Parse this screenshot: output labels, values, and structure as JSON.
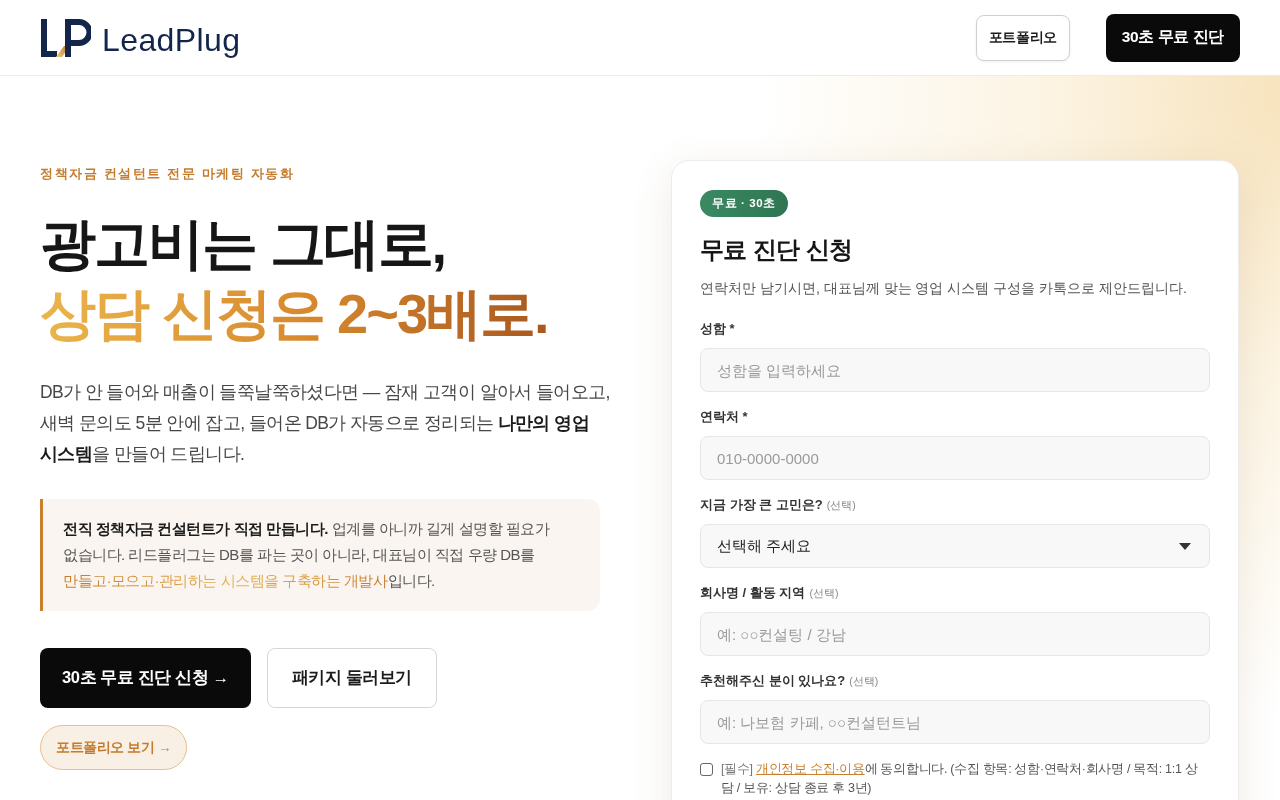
{
  "header": {
    "logo_text": "LeadPlug",
    "buttons": [
      {
        "label": "포트폴리오",
        "kind": "outline"
      },
      {
        "label": "30초 무료 진단",
        "kind": "solid"
      }
    ]
  },
  "hero": {
    "eyebrow": "정책자금 컨설턴트 전문 마케팅 자동화",
    "headline": [
      {
        "text": "광고비는 그대로,",
        "kind": "plain"
      },
      {
        "text": "상담 신청은 2~3배로.",
        "kind": "gradient"
      }
    ],
    "lead": "DB가 안 들어와 매출이 들쭉날쭉하셨다면 — 잠재 고객이 알아서 들어오고, 새벽 문의도 5분 안에 잡고, 들어온 DB가 자동으로 정리되는 **나만의 영업 시스템**을 만들어 드립니다.",
    "callout": [
      {
        "text": "전직 정책자금 컨설턴트가 직접 만듭니다.",
        "kind": "strong"
      },
      {
        "text": " 업계를 아니까 길게 설명할 필요가 없습니다. 리드플러그는 DB를 파는 곳이 아니라, 대표님이 직접 우량 DB를 ",
        "kind": "plain"
      },
      {
        "text": "만들고·모으고·관리하는 시스템을 구축하는 개발사",
        "kind": "highlight"
      },
      {
        "text": "입니다.",
        "kind": "plain"
      }
    ],
    "buttons": [
      {
        "label": "30초 무료 진단 신청 →",
        "kind": "primary"
      },
      {
        "label": "패키지 둘러보기",
        "kind": "secondary"
      },
      {
        "label": "포트폴리오 보기 →",
        "kind": "pill"
      }
    ]
  },
  "form": {
    "badge": "무료 · 30초",
    "title": "무료 진단 신청",
    "subtitle": "연락처만 남기시면, 대표님께 맞는 영업 시스템 구성을 카톡으로 제안드립니다.",
    "fields": [
      {
        "label": "성함 *",
        "kind": "text",
        "placeholder": "성함을 입력하세요"
      },
      {
        "label": "연락처 *",
        "kind": "text",
        "placeholder": "010-0000-0000"
      },
      {
        "label": "지금 가장 큰 고민은?",
        "hint": "(선택)",
        "kind": "select",
        "value": "선택해 주세요"
      },
      {
        "label": "회사명 / 활동 지역",
        "hint": "(선택)",
        "kind": "text",
        "placeholder": "예: ○○컨설팅 / 강남"
      },
      {
        "label": "추천해주신 분이 있나요?",
        "hint": "(선택)",
        "kind": "text",
        "placeholder": "예: 나보험 카페, ○○컨설턴트님"
      }
    ],
    "consent": {
      "checked": false,
      "tag": "[필수]",
      "link": "개인정보 수집·이용",
      "text": "에 동의합니다. (수집 항목: 성함·연락처·회사명 / 목적: 1:1 상담 / 보유: 상담 종료 후 3년)"
    }
  }
}
